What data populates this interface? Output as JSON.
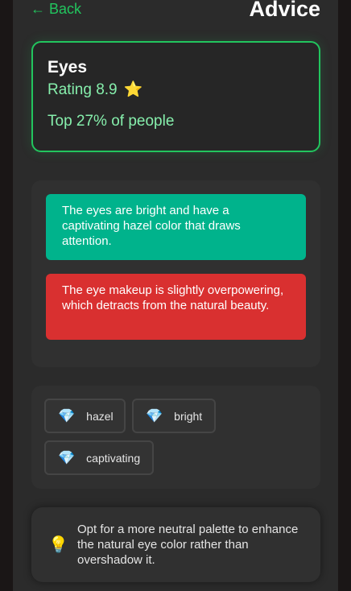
{
  "header": {
    "back_label": "← Back",
    "title": "Advice"
  },
  "rating_card": {
    "feature": "Eyes",
    "rating_label": "Rating 8.9",
    "star_icon": "⭐",
    "percentile": "Top 27% of people"
  },
  "feedback": [
    {
      "type": "positive",
      "text": "The eyes are bright and have a captivating hazel color that draws attention."
    },
    {
      "type": "negative",
      "text": "The eye makeup is slightly overpowering, which detracts from the natural beauty."
    }
  ],
  "tags": [
    {
      "icon": "💎",
      "label": "hazel"
    },
    {
      "icon": "💎",
      "label": "bright"
    },
    {
      "icon": "💎",
      "label": "captivating"
    }
  ],
  "tip": {
    "icon": "💡",
    "text": "Opt for a more neutral palette to enhance the natural eye color rather than overshadow it."
  },
  "colors": {
    "accent_green": "#22c55e",
    "positive_bg": "#00b38c",
    "negative_bg": "#d93030"
  }
}
